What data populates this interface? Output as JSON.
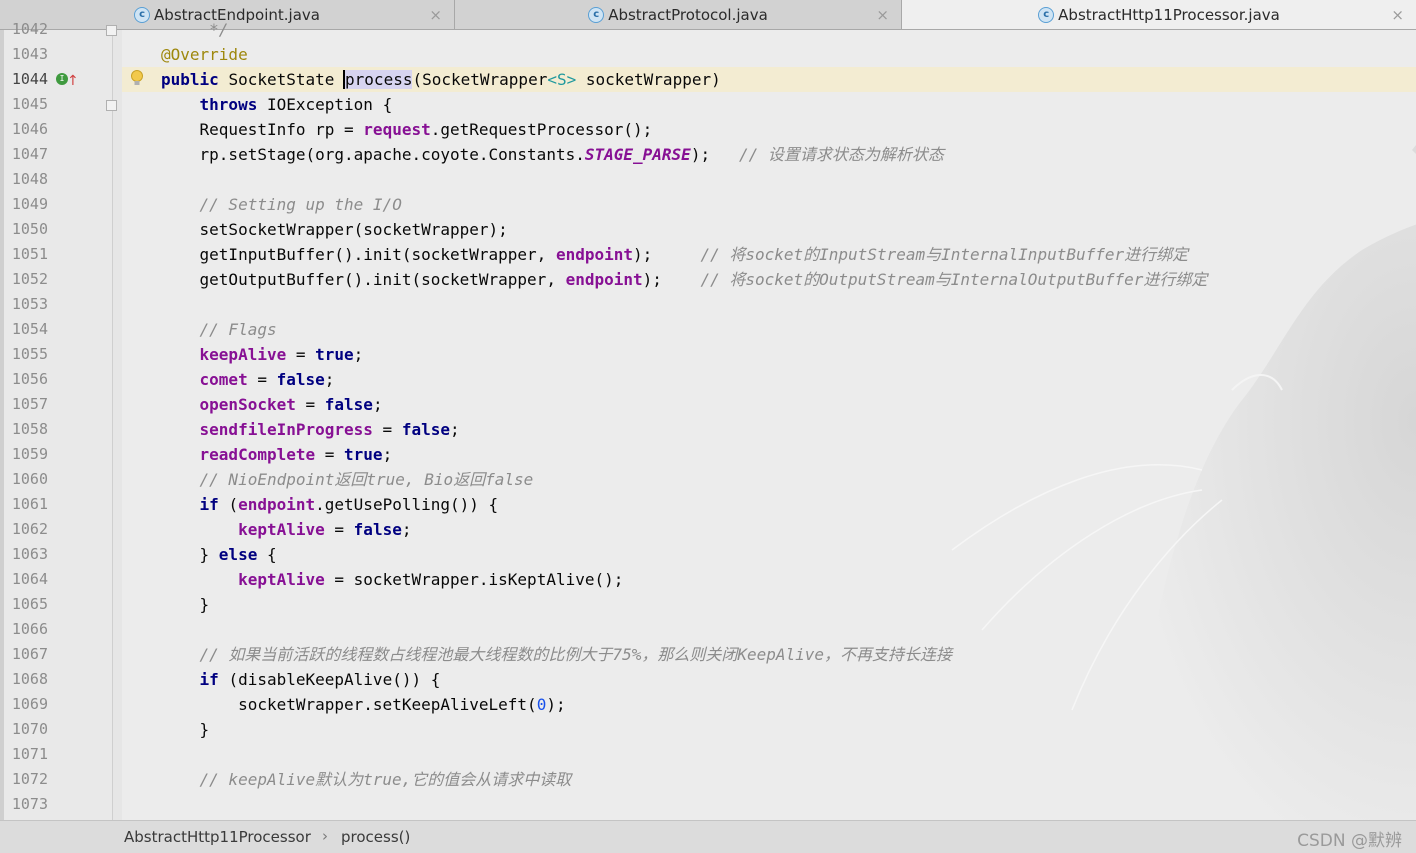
{
  "tabs": [
    {
      "icon": "c",
      "label": "AbstractEndpoint.java",
      "active": false
    },
    {
      "icon": "c",
      "label": "AbstractProtocol.java",
      "active": false
    },
    {
      "icon": "c",
      "label": "AbstractHttp11Processor.java",
      "active": true
    }
  ],
  "tab_close_glyph": "×",
  "lines": [
    {
      "num": "1042",
      "segs": [
        {
          "t": "     */",
          "c": "cmt"
        }
      ]
    },
    {
      "num": "1043",
      "segs": [
        {
          "t": "@Override",
          "c": "ann"
        }
      ]
    },
    {
      "num": "1044",
      "segs": [
        {
          "t": "public ",
          "c": "kw2"
        },
        {
          "t": "SocketState ",
          "c": ""
        },
        {
          "t": "process",
          "c": "hl caret"
        },
        {
          "t": "(SocketWrapper",
          "c": ""
        },
        {
          "t": "<S>",
          "c": "gen"
        },
        {
          "t": " socketWrapper)",
          "c": ""
        }
      ]
    },
    {
      "num": "1045",
      "segs": [
        {
          "t": "    throws ",
          "c": "kw2"
        },
        {
          "t": "IOException {",
          "c": ""
        }
      ]
    },
    {
      "num": "1046",
      "segs": [
        {
          "t": "    RequestInfo rp = ",
          "c": ""
        },
        {
          "t": "request",
          "c": "fld"
        },
        {
          "t": ".getRequestProcessor();",
          "c": ""
        }
      ]
    },
    {
      "num": "1047",
      "segs": [
        {
          "t": "    rp.setStage(org.apache.coyote.Constants.",
          "c": ""
        },
        {
          "t": "STAGE_PARSE",
          "c": "cst"
        },
        {
          "t": ");   ",
          "c": ""
        },
        {
          "t": "// 设置请求状态为解析状态",
          "c": "cmt"
        }
      ]
    },
    {
      "num": "1048",
      "segs": []
    },
    {
      "num": "1049",
      "segs": [
        {
          "t": "    // Setting up the I/O",
          "c": "cmt"
        }
      ]
    },
    {
      "num": "1050",
      "segs": [
        {
          "t": "    setSocketWrapper(socketWrapper);",
          "c": ""
        }
      ]
    },
    {
      "num": "1051",
      "segs": [
        {
          "t": "    getInputBuffer().init(socketWrapper, ",
          "c": ""
        },
        {
          "t": "endpoint",
          "c": "fld"
        },
        {
          "t": ");     ",
          "c": ""
        },
        {
          "t": "// 将socket的InputStream与InternalInputBuffer进行绑定",
          "c": "cmt"
        }
      ]
    },
    {
      "num": "1052",
      "segs": [
        {
          "t": "    getOutputBuffer().init(socketWrapper, ",
          "c": ""
        },
        {
          "t": "endpoint",
          "c": "fld"
        },
        {
          "t": ");    ",
          "c": ""
        },
        {
          "t": "// 将socket的OutputStream与InternalOutputBuffer进行绑定",
          "c": "cmt"
        }
      ]
    },
    {
      "num": "1053",
      "segs": []
    },
    {
      "num": "1054",
      "segs": [
        {
          "t": "    // Flags",
          "c": "cmt"
        }
      ]
    },
    {
      "num": "1055",
      "segs": [
        {
          "t": "    ",
          "c": ""
        },
        {
          "t": "keepAlive",
          "c": "fld"
        },
        {
          "t": " = ",
          "c": ""
        },
        {
          "t": "true",
          "c": "kw2"
        },
        {
          "t": ";",
          "c": ""
        }
      ]
    },
    {
      "num": "1056",
      "segs": [
        {
          "t": "    ",
          "c": ""
        },
        {
          "t": "comet",
          "c": "fld"
        },
        {
          "t": " = ",
          "c": ""
        },
        {
          "t": "false",
          "c": "kw2"
        },
        {
          "t": ";",
          "c": ""
        }
      ]
    },
    {
      "num": "1057",
      "segs": [
        {
          "t": "    ",
          "c": ""
        },
        {
          "t": "openSocket",
          "c": "fld"
        },
        {
          "t": " = ",
          "c": ""
        },
        {
          "t": "false",
          "c": "kw2"
        },
        {
          "t": ";",
          "c": ""
        }
      ]
    },
    {
      "num": "1058",
      "segs": [
        {
          "t": "    ",
          "c": ""
        },
        {
          "t": "sendfileInProgress",
          "c": "fld"
        },
        {
          "t": " = ",
          "c": ""
        },
        {
          "t": "false",
          "c": "kw2"
        },
        {
          "t": ";",
          "c": ""
        }
      ]
    },
    {
      "num": "1059",
      "segs": [
        {
          "t": "    ",
          "c": ""
        },
        {
          "t": "readComplete",
          "c": "fld"
        },
        {
          "t": " = ",
          "c": ""
        },
        {
          "t": "true",
          "c": "kw2"
        },
        {
          "t": ";",
          "c": ""
        }
      ]
    },
    {
      "num": "1060",
      "segs": [
        {
          "t": "    // NioEndpoint返回true, Bio返回false",
          "c": "cmt"
        }
      ]
    },
    {
      "num": "1061",
      "segs": [
        {
          "t": "    if ",
          "c": "kw2"
        },
        {
          "t": "(",
          "c": ""
        },
        {
          "t": "endpoint",
          "c": "fld"
        },
        {
          "t": ".getUsePolling()) {",
          "c": ""
        }
      ]
    },
    {
      "num": "1062",
      "segs": [
        {
          "t": "        ",
          "c": ""
        },
        {
          "t": "keptAlive",
          "c": "fld"
        },
        {
          "t": " = ",
          "c": ""
        },
        {
          "t": "false",
          "c": "kw2"
        },
        {
          "t": ";",
          "c": ""
        }
      ]
    },
    {
      "num": "1063",
      "segs": [
        {
          "t": "    } ",
          "c": ""
        },
        {
          "t": "else",
          "c": "kw2"
        },
        {
          "t": " {",
          "c": ""
        }
      ]
    },
    {
      "num": "1064",
      "segs": [
        {
          "t": "        ",
          "c": ""
        },
        {
          "t": "keptAlive",
          "c": "fld"
        },
        {
          "t": " = socketWrapper.isKeptAlive();",
          "c": ""
        }
      ]
    },
    {
      "num": "1065",
      "segs": [
        {
          "t": "    }",
          "c": ""
        }
      ]
    },
    {
      "num": "1066",
      "segs": []
    },
    {
      "num": "1067",
      "segs": [
        {
          "t": "    // 如果当前活跃的线程数占线程池最大线程数的比例大于75%，那么则关闭KeepAlive，不再支持长连接",
          "c": "cmt"
        }
      ]
    },
    {
      "num": "1068",
      "segs": [
        {
          "t": "    if ",
          "c": "kw2"
        },
        {
          "t": "(disableKeepAlive()) {",
          "c": ""
        }
      ]
    },
    {
      "num": "1069",
      "segs": [
        {
          "t": "        socketWrapper.setKeepAliveLeft(",
          "c": ""
        },
        {
          "t": "0",
          "c": "num"
        },
        {
          "t": ");",
          "c": ""
        }
      ]
    },
    {
      "num": "1070",
      "segs": [
        {
          "t": "    }",
          "c": ""
        }
      ]
    },
    {
      "num": "1071",
      "segs": []
    },
    {
      "num": "1072",
      "segs": [
        {
          "t": "    // keepAlive默认为true,它的值会从请求中读取",
          "c": "cmt"
        }
      ]
    },
    {
      "num": "1073",
      "segs": []
    }
  ],
  "current_line": "1044",
  "breadcrumb": {
    "class_name": "AbstractHttp11Processor",
    "separator": "›",
    "method": "process()"
  },
  "watermark_text": "CSDN @默辨",
  "colors": {
    "keyword": "#000080",
    "field": "#871094",
    "comment": "#8c8c8c",
    "annotation": "#9e880d",
    "number": "#1750eb",
    "generic": "#20999d"
  }
}
